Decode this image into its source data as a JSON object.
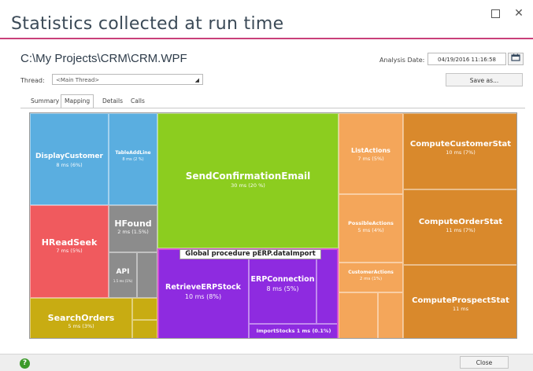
{
  "window": {
    "title": "Statistics collected at run time",
    "maximize_label": "",
    "close_label": "✕"
  },
  "header": {
    "project_path": "C:\\My Projects\\CRM\\CRM.WPF",
    "thread_label": "Thread:",
    "thread_value": "<Main Thread>",
    "analysis_date_label": "Analysis Date:",
    "analysis_date_value": "04/19/2016 11:16:58",
    "calendar_icon": "calendar-icon",
    "save_label": "Save as..."
  },
  "tabs": [
    {
      "label": "Summary",
      "active": false
    },
    {
      "label": "Mapping",
      "active": true
    },
    {
      "label": "Details",
      "active": false
    },
    {
      "label": "Calls",
      "active": false
    }
  ],
  "treemap": {
    "cells": [
      {
        "name": "DisplayCustomer",
        "value": "8 ms (6%)",
        "color": "#5aaee0"
      },
      {
        "name": "TableAddLine",
        "value": "8 ms (2 %)",
        "color": "#5aaee0"
      },
      {
        "name": "HReadSeek",
        "value": "7 ms (5%)",
        "color": "#f05a5e"
      },
      {
        "name": "HFound",
        "value": "2 ms (1.5%)",
        "color": "#8c8c8c"
      },
      {
        "name": "API",
        "value": "1.5 ms (1%)",
        "color": "#8c8c8c"
      },
      {
        "name": "SearchOrders",
        "value": "5 ms (3%)",
        "color": "#c8ac12"
      },
      {
        "name": "SendConfirmationEmail",
        "value": "30 ms (20 %)",
        "color": "#8ccd1f"
      },
      {
        "name": "RetrieveERPStock",
        "value": "10 ms (8%)",
        "color": "#8e2be0"
      },
      {
        "name": "ERPConnection",
        "value": "8 ms (5%)",
        "color": "#8e2be0"
      },
      {
        "name": "ImportStocks",
        "value": "1 ms (0.1%)",
        "color": "#8e2be0"
      },
      {
        "name": "ListActions",
        "value": "7 ms (5%)",
        "color": "#f4a65a"
      },
      {
        "name": "PossibleActions",
        "value": "5 ms (4%)",
        "color": "#f4a65a"
      },
      {
        "name": "CustomerActions",
        "value": "2 ms (1%)",
        "color": "#f4a65a"
      },
      {
        "name": "ComputeCustomerStat",
        "value": "10 ms (7%)",
        "color": "#d9892c"
      },
      {
        "name": "ComputeOrderStat",
        "value": "11 ms (7%)",
        "color": "#d9892c"
      },
      {
        "name": "ComputeProspectStat",
        "value": "11 ms",
        "color": "#d9892c"
      }
    ],
    "group_label": "Global procedure pERP.dataImport",
    "group_color": "#d44fd3",
    "filler_colors": {
      "blue": "#5aaee0",
      "red": "#f05a5e",
      "gray": "#8c8c8c",
      "olive": "#c8ac12",
      "purple": "#8e2be0",
      "orange": "#f4a65a"
    }
  },
  "footer": {
    "help_icon": "help-icon",
    "help_glyph": "?",
    "close_label": "Close"
  }
}
